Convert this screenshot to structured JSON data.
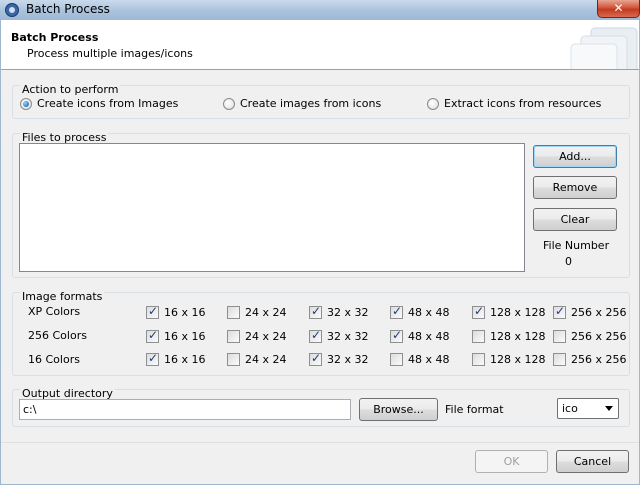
{
  "window": {
    "title": "Batch Process",
    "close_label": "✕"
  },
  "header": {
    "title": "Batch Process",
    "subtitle": "Process multiple images/icons"
  },
  "action": {
    "label": "Action to perform",
    "options": [
      {
        "label": "Create icons from Images",
        "selected": true
      },
      {
        "label": "Create images from icons",
        "selected": false
      },
      {
        "label": "Extract icons from resources",
        "selected": false
      }
    ]
  },
  "files": {
    "label": "Files to process",
    "items": [],
    "add_label": "Add...",
    "remove_label": "Remove",
    "clear_label": "Clear",
    "file_number_label": "File Number",
    "file_number_value": "0"
  },
  "formats": {
    "label": "Image formats",
    "rows": [
      {
        "label": "XP Colors",
        "sizes": [
          {
            "label": "16 x 16",
            "checked": true
          },
          {
            "label": "24 x 24",
            "checked": false
          },
          {
            "label": "32 x 32",
            "checked": true
          },
          {
            "label": "48 x 48",
            "checked": true
          },
          {
            "label": "128 x 128",
            "checked": true
          },
          {
            "label": "256 x 256",
            "checked": true
          }
        ]
      },
      {
        "label": "256 Colors",
        "sizes": [
          {
            "label": "16 x 16",
            "checked": true
          },
          {
            "label": "24 x 24",
            "checked": false
          },
          {
            "label": "32 x 32",
            "checked": true
          },
          {
            "label": "48 x 48",
            "checked": true
          },
          {
            "label": "128 x 128",
            "checked": false
          },
          {
            "label": "256 x 256",
            "checked": false
          }
        ]
      },
      {
        "label": "16 Colors",
        "sizes": [
          {
            "label": "16 x 16",
            "checked": true
          },
          {
            "label": "24 x 24",
            "checked": false
          },
          {
            "label": "32 x 32",
            "checked": true
          },
          {
            "label": "48 x 48",
            "checked": false
          },
          {
            "label": "128 x 128",
            "checked": false
          },
          {
            "label": "256 x 256",
            "checked": false
          }
        ]
      }
    ]
  },
  "output": {
    "label": "Output directory",
    "directory_value": "c:\\",
    "browse_label": "Browse...",
    "file_format_label": "File format",
    "file_format_value": "ico"
  },
  "footer": {
    "ok_label": "OK",
    "cancel_label": "Cancel"
  },
  "colors": {
    "titlebar": "#aac2dd",
    "close": "#c23a1e",
    "dialog_bg": "#f0f0f0",
    "focus_border": "#3c7fb1"
  }
}
